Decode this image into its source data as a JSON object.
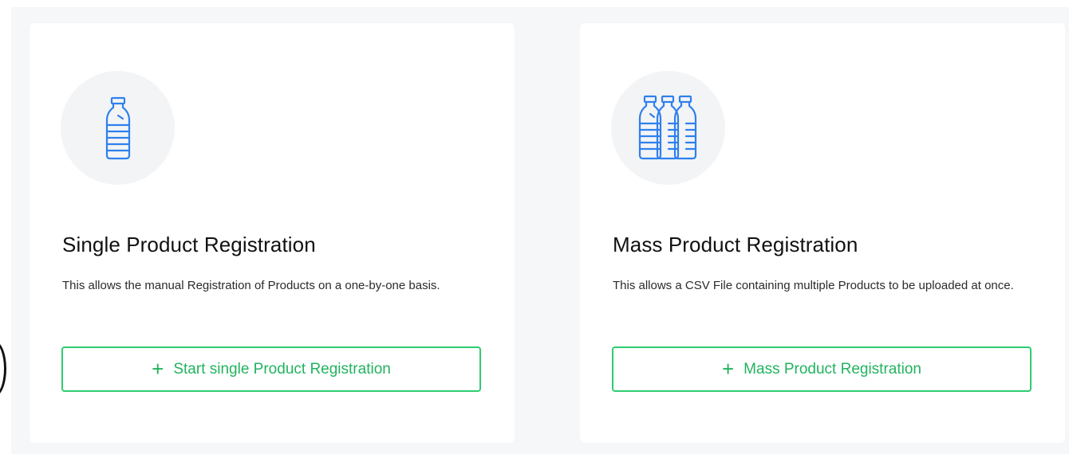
{
  "colors": {
    "accent": "#2ecc71",
    "icon": "#2f80ed",
    "background": "#f6f7f9"
  },
  "cards": [
    {
      "icon": "single-bottle-icon",
      "title": "Single Product Registration",
      "description": "This allows the manual Registration of Products on a one-by-one basis.",
      "button_label": "Start single Product Registration",
      "button_icon": "plus-icon"
    },
    {
      "icon": "multiple-bottles-icon",
      "title": "Mass Product Registration",
      "description": "This allows a CSV File containing multiple Products to be uploaded at once.",
      "button_label": "Mass Product Registration",
      "button_icon": "plus-icon"
    }
  ]
}
